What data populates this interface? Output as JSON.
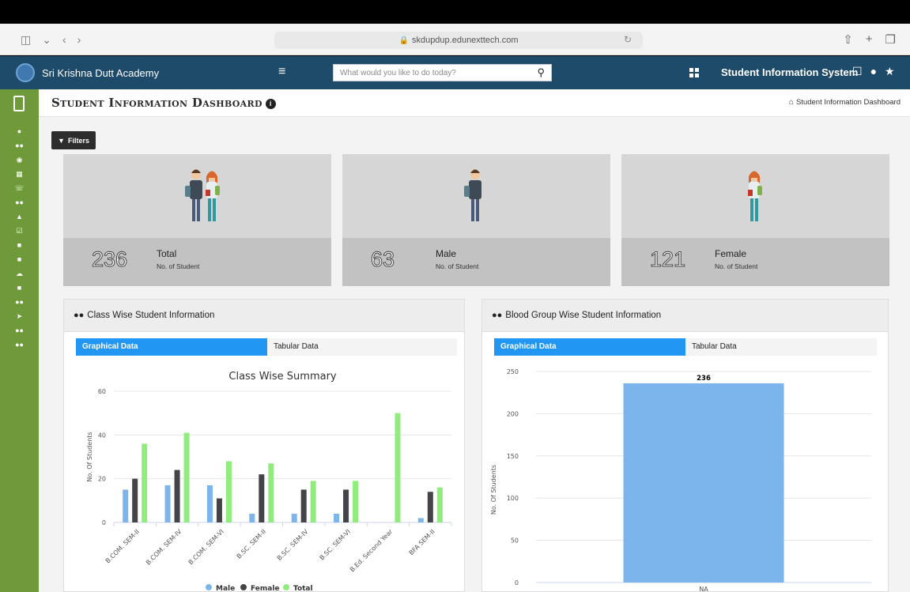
{
  "browser": {
    "url": "skdupdup.edunexttech.com"
  },
  "header": {
    "school_name": "Sri Krishna Dutt Academy",
    "search_placeholder": "What would you like to do today?",
    "system_title": "Student Information System"
  },
  "page": {
    "title": "Student Information Dashboard",
    "breadcrumb": "Student Information Dashboard",
    "filters_label": "Filters"
  },
  "stats": [
    {
      "value": "236",
      "label": "Total",
      "sub": "No. of Student"
    },
    {
      "value": "63",
      "label": "Male",
      "sub": "No. of Student"
    },
    {
      "value": "121",
      "label": "Female",
      "sub": "No. of Student"
    }
  ],
  "class_card": {
    "title": "Class Wise Student Information",
    "tab_graph": "Graphical Data",
    "tab_table": "Tabular Data"
  },
  "blood_card": {
    "title": "Blood Group Wise Student Information",
    "tab_graph": "Graphical Data",
    "tab_table": "Tabular Data"
  },
  "colors": {
    "male": "#7cb5ec",
    "female": "#434348",
    "total": "#90ed7d",
    "header": "#1f4b6a",
    "sidebar": "#6e9a3a",
    "tab_active": "#2196f3"
  },
  "chart_data": [
    {
      "type": "bar",
      "title": "Class Wise Summary",
      "xlabel": "",
      "ylabel": "No. Of Students",
      "ylim": [
        0,
        60
      ],
      "yticks": [
        0,
        20,
        40,
        60
      ],
      "categories": [
        "B.COM. SEM-II",
        "B.COM. SEM-IV",
        "B.COM. SEM-VI",
        "B.SC. SEM-II",
        "B.SC. SEM-IV",
        "B.SC. SEM-VI",
        "B.Ed. Second Year",
        "BFA SEM-II"
      ],
      "series": [
        {
          "name": "Male",
          "values": [
            15,
            17,
            17,
            4,
            4,
            4,
            0,
            2
          ]
        },
        {
          "name": "Female",
          "values": [
            20,
            24,
            11,
            22,
            15,
            15,
            0,
            14
          ]
        },
        {
          "name": "Total",
          "values": [
            36,
            41,
            28,
            27,
            19,
            19,
            50,
            16
          ]
        }
      ],
      "legend": "bottom"
    },
    {
      "type": "bar",
      "title": "",
      "xlabel": "",
      "ylabel": "No. Of Students",
      "ylim": [
        0,
        250
      ],
      "yticks": [
        0,
        50,
        100,
        150,
        200,
        250
      ],
      "categories": [
        "NA"
      ],
      "values": [
        236
      ],
      "data_labels": [
        "236"
      ]
    }
  ]
}
